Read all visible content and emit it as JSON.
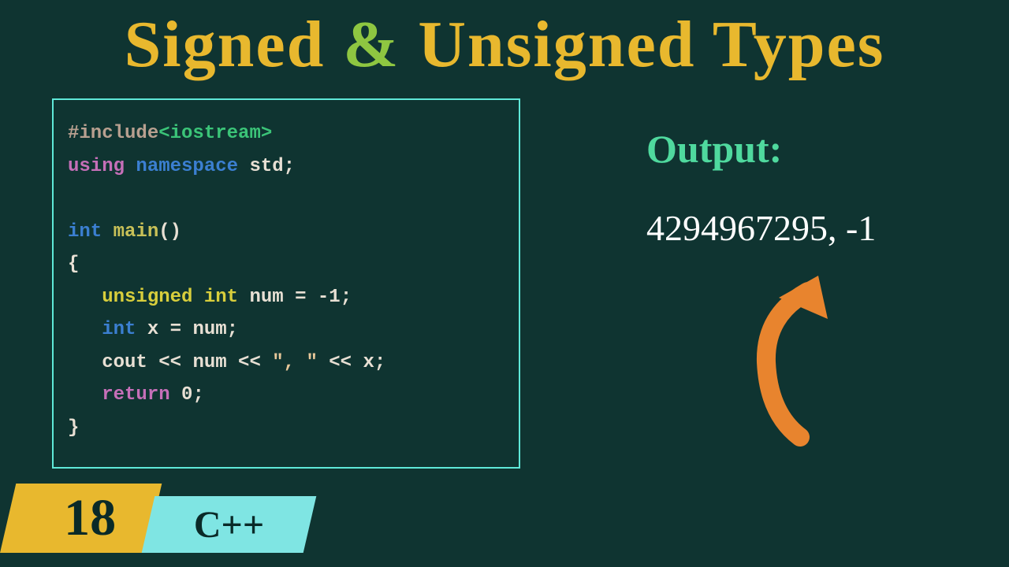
{
  "title": {
    "part1": "Signed",
    "amp": "&",
    "part2": "Unsigned Types"
  },
  "code": {
    "l1a": "#include",
    "l1b": "<iostream>",
    "l2a": "using",
    "l2b": "namespace",
    "l2c": "std",
    "l2d": ";",
    "l3a": "int",
    "l3b": "main",
    "l3c": "()",
    "l4": "{",
    "l5a": "unsigned int",
    "l5b": "num",
    "l5c": " = ",
    "l5d": "-1",
    "l5e": ";",
    "l6a": "int",
    "l6b": " x = num;",
    "l7a": "cout << num << ",
    "l7b": "\", \"",
    "l7c": " << x;",
    "l8a": "return",
    "l8b": " 0",
    "l8c": ";",
    "l9": "}"
  },
  "output": {
    "label": "Output:",
    "value": "4294967295, -1"
  },
  "badges": {
    "num": "18",
    "lang": "C++"
  }
}
